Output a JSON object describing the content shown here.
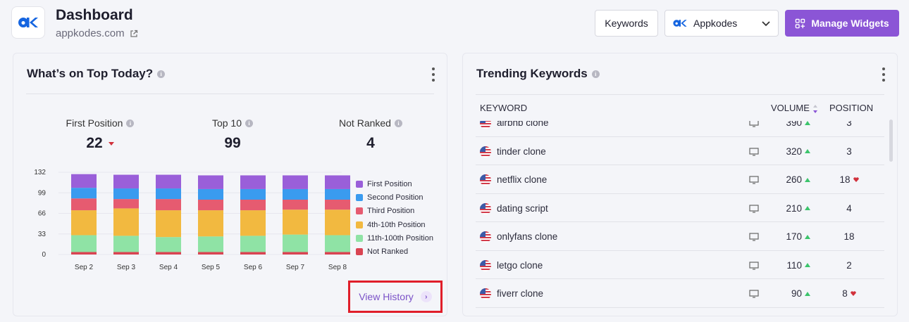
{
  "header": {
    "title": "Dashboard",
    "site": "appkodes.com",
    "keywords_button": "Keywords",
    "project_select": "Appkodes",
    "manage_widgets_button": "Manage Widgets"
  },
  "top_today": {
    "title": "What’s on Top Today?",
    "stats": [
      {
        "label": "First Position",
        "value": "22",
        "trend": "down"
      },
      {
        "label": "Top 10",
        "value": "99",
        "trend": "none"
      },
      {
        "label": "Not Ranked",
        "value": "4",
        "trend": "none"
      }
    ],
    "view_history": "View History"
  },
  "chart_data": {
    "type": "bar",
    "stacked": true,
    "categories": [
      "Sep 2",
      "Sep 3",
      "Sep 4",
      "Sep 5",
      "Sep 6",
      "Sep 7",
      "Sep 8"
    ],
    "yticks": [
      "132",
      "99",
      "66",
      "33",
      "0"
    ],
    "ylim": [
      0,
      132
    ],
    "series": [
      {
        "name": "Not Ranked",
        "color": "#d94452",
        "values": [
          4,
          4,
          4,
          4,
          4,
          4,
          4
        ]
      },
      {
        "name": "11th-100th Position",
        "color": "#8fe3a5",
        "values": [
          27,
          26,
          24,
          25,
          26,
          28,
          27
        ]
      },
      {
        "name": "4th-10th Position",
        "color": "#f2b940",
        "values": [
          40,
          44,
          43,
          42,
          41,
          40,
          41
        ]
      },
      {
        "name": "Third Position",
        "color": "#e65b70",
        "values": [
          19,
          15,
          18,
          17,
          17,
          16,
          16
        ]
      },
      {
        "name": "Second Position",
        "color": "#3a9bef",
        "values": [
          17,
          17,
          17,
          17,
          17,
          17,
          17
        ]
      },
      {
        "name": "First Position",
        "color": "#9a5fd9",
        "values": [
          22,
          22,
          22,
          22,
          22,
          22,
          22
        ]
      }
    ],
    "legend": [
      "First Position",
      "Second Position",
      "Third Position",
      "4th-10th Position",
      "11th-100th Position",
      "Not Ranked"
    ],
    "legend_position": "right"
  },
  "trending": {
    "title": "Trending Keywords",
    "columns": [
      "KEYWORD",
      "VOLUME",
      "POSITION"
    ],
    "rows": [
      {
        "keyword": "airbnb clone",
        "volume": "390",
        "position": "3",
        "pos_trend": "none"
      },
      {
        "keyword": "tinder clone",
        "volume": "320",
        "position": "3",
        "pos_trend": "none"
      },
      {
        "keyword": "netflix clone",
        "volume": "260",
        "position": "18",
        "pos_trend": "down"
      },
      {
        "keyword": "dating script",
        "volume": "210",
        "position": "4",
        "pos_trend": "none"
      },
      {
        "keyword": "onlyfans clone",
        "volume": "170",
        "position": "18",
        "pos_trend": "none"
      },
      {
        "keyword": "letgo clone",
        "volume": "110",
        "position": "2",
        "pos_trend": "none"
      },
      {
        "keyword": "fiverr clone",
        "volume": "90",
        "position": "8",
        "pos_trend": "down"
      }
    ]
  },
  "colors": {
    "accent": "#8b55d6",
    "up": "#3cc46c",
    "down": "#d1313c",
    "highlight_box": "#e01e2a"
  }
}
